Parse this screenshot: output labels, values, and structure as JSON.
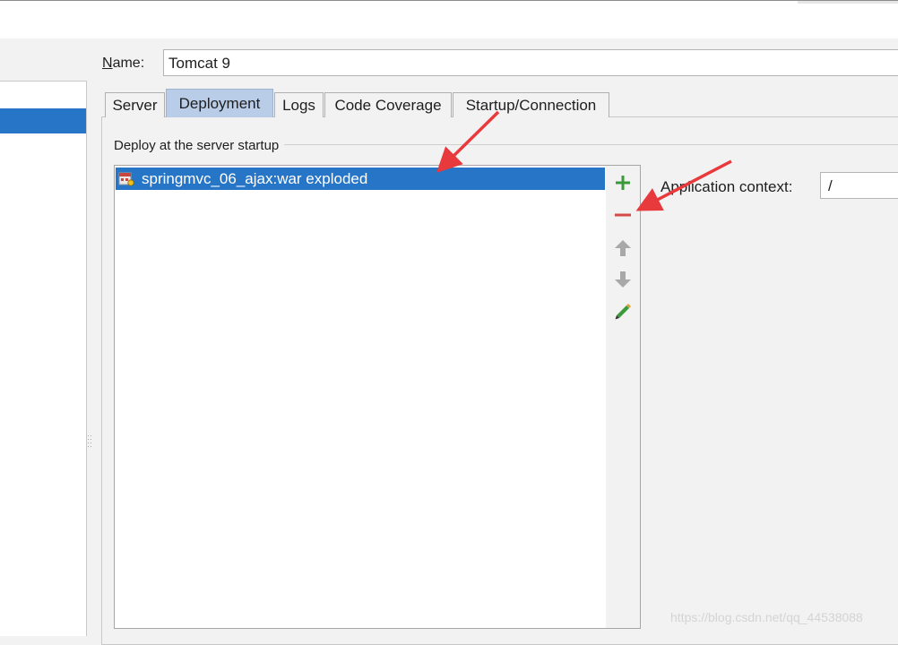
{
  "name_label": {
    "mnemonic": "N",
    "rest": "ame:"
  },
  "name_value": "Tomcat 9",
  "tabs": [
    {
      "label": "Server",
      "active": false
    },
    {
      "label": "Deployment",
      "active": true
    },
    {
      "label": "Logs",
      "active": false
    },
    {
      "label": "Code Coverage",
      "active": false
    },
    {
      "label": "Startup/Connection",
      "active": false
    }
  ],
  "deploy_group_label": "Deploy at the server startup",
  "artifacts": [
    {
      "label": "springmvc_06_ajax:war exploded",
      "icon": "war-exploded-icon",
      "selected": true
    }
  ],
  "toolbar": {
    "add": {
      "icon": "plus-icon",
      "color": "#3a9a3a"
    },
    "remove": {
      "icon": "minus-icon",
      "color": "#d44a4a"
    },
    "move_up": {
      "icon": "arrow-up-icon",
      "color": "#a8a8a8"
    },
    "move_down": {
      "icon": "arrow-down-icon",
      "color": "#a8a8a8"
    },
    "edit": {
      "icon": "pencil-icon",
      "color": "#3c9a3c"
    }
  },
  "application_context_label": "Application context:",
  "application_context_value": "/",
  "annotations": {
    "arrow_color": "#e8393c"
  },
  "watermark": "https://blog.csdn.net/qq_44538088",
  "colors": {
    "selection": "#2775c6",
    "active_tab": "#b9cde9",
    "background": "#f2f2f2"
  }
}
